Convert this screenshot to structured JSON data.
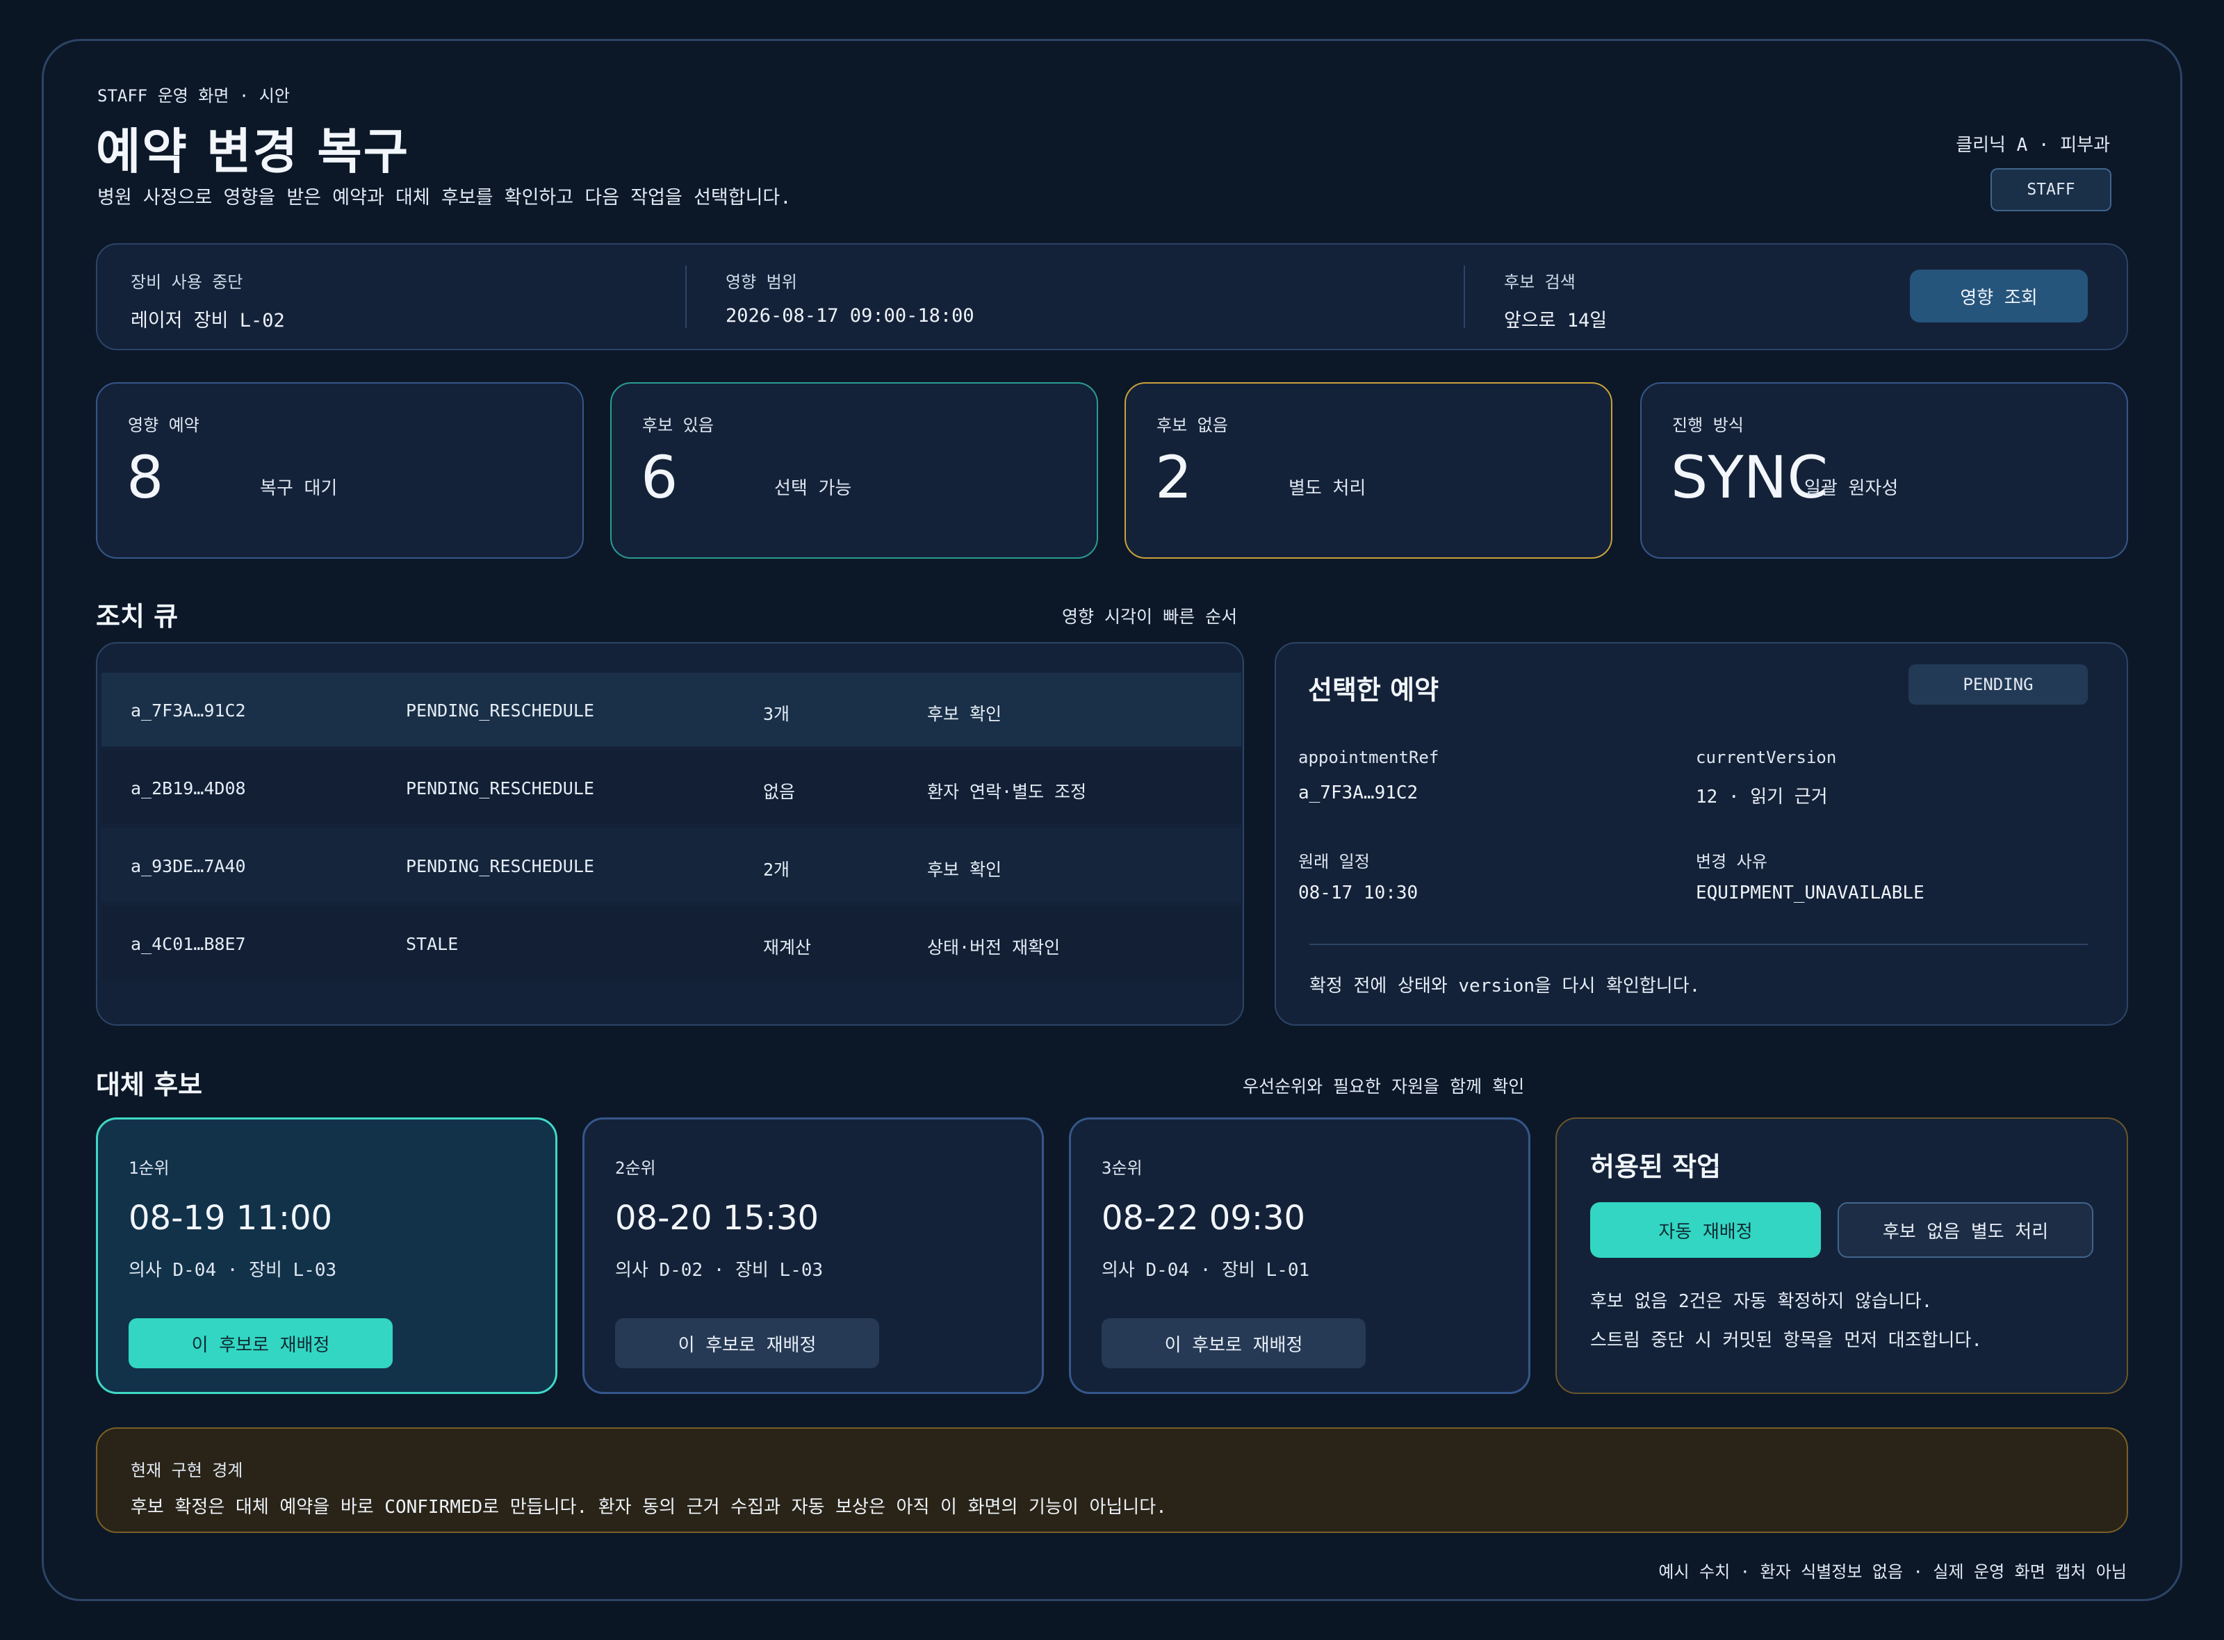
{
  "header": {
    "eyebrow": "STAFF 운영 화면 · 시안",
    "title": "예약 변경 복구",
    "subtitle": "병원 사정으로 영향을 받은 예약과 대체 후보를 확인하고 다음 작업을 선택합니다.",
    "clinic": "클리닉 A · 피부과",
    "role": "STAFF"
  },
  "scope": {
    "items": [
      {
        "label": "장비 사용 중단",
        "value": "레이저 장비 L-02"
      },
      {
        "label": "영향 범위",
        "value": "2026-08-17 09:00-18:00"
      },
      {
        "label": "후보 검색",
        "value": "앞으로 14일"
      }
    ],
    "button": "영향 조회"
  },
  "kpis": [
    {
      "label": "영향 예약",
      "value": "8",
      "sub": "복구 대기"
    },
    {
      "label": "후보 있음",
      "value": "6",
      "sub": "선택 가능"
    },
    {
      "label": "후보 없음",
      "value": "2",
      "sub": "별도 처리"
    },
    {
      "label": "진행 방식",
      "value": "SYNC",
      "sub": "일괄 원자성"
    }
  ],
  "queue": {
    "title": "조치 큐",
    "note": "영향 시각이 빠른 순서",
    "rows": [
      {
        "ref": "a_7F3A…91C2",
        "state": "PENDING_RESCHEDULE",
        "candidates": "3개",
        "action": "후보 확인"
      },
      {
        "ref": "a_2B19…4D08",
        "state": "PENDING_RESCHEDULE",
        "candidates": "없음",
        "action": "환자 연락·별도 조정"
      },
      {
        "ref": "a_93DE…7A40",
        "state": "PENDING_RESCHEDULE",
        "candidates": "2개",
        "action": "후보 확인"
      },
      {
        "ref": "a_4C01…B8E7",
        "state": "STALE",
        "candidates": "재계산",
        "action": "상태·버전 재확인"
      }
    ]
  },
  "detail": {
    "title": "선택한 예약",
    "badge": "PENDING",
    "fields": [
      {
        "label": "appointmentRef",
        "value": "a_7F3A…91C2"
      },
      {
        "label": "currentVersion",
        "value": "12 · 읽기 근거"
      },
      {
        "label": "원래 일정",
        "value": "08-17 10:30"
      },
      {
        "label": "변경 사유",
        "value": "EQUIPMENT_UNAVAILABLE"
      }
    ],
    "note": "확정 전에 상태와 version을 다시 확인합니다."
  },
  "candidates": {
    "title": "대체 후보",
    "note": "우선순위와 필요한 자원을 함께 확인",
    "items": [
      {
        "rank": "1순위",
        "time": "08-19 11:00",
        "resources": "의사 D-04 · 장비 L-03",
        "button": "이 후보로 재배정"
      },
      {
        "rank": "2순위",
        "time": "08-20 15:30",
        "resources": "의사 D-02 · 장비 L-03",
        "button": "이 후보로 재배정"
      },
      {
        "rank": "3순위",
        "time": "08-22 09:30",
        "resources": "의사 D-04 · 장비 L-01",
        "button": "이 후보로 재배정"
      }
    ]
  },
  "actions": {
    "title": "허용된 작업",
    "primary": "자동 재배정",
    "secondary": "후보 없음 별도 처리",
    "note1": "후보 없음 2건은 자동 확정하지 않습니다.",
    "note2": "스트림 중단 시 커밋된 항목을 먼저 대조합니다."
  },
  "boundary": {
    "label": "현재 구현 경계",
    "text": "후보 확정은 대체 예약을 바로 CONFIRMED로 만듭니다. 환자 동의 근거 수집과 자동 보상은 아직 이 화면의 기능이 아닙니다."
  },
  "footer": "예시 수치 · 환자 식별정보 없음 · 실제 운영 화면 캡처 아님",
  "colors": {
    "accent_teal": "#33d6c2",
    "warning_amber": "#c9a23a",
    "panel": "#142239",
    "background": "#0b1624"
  }
}
